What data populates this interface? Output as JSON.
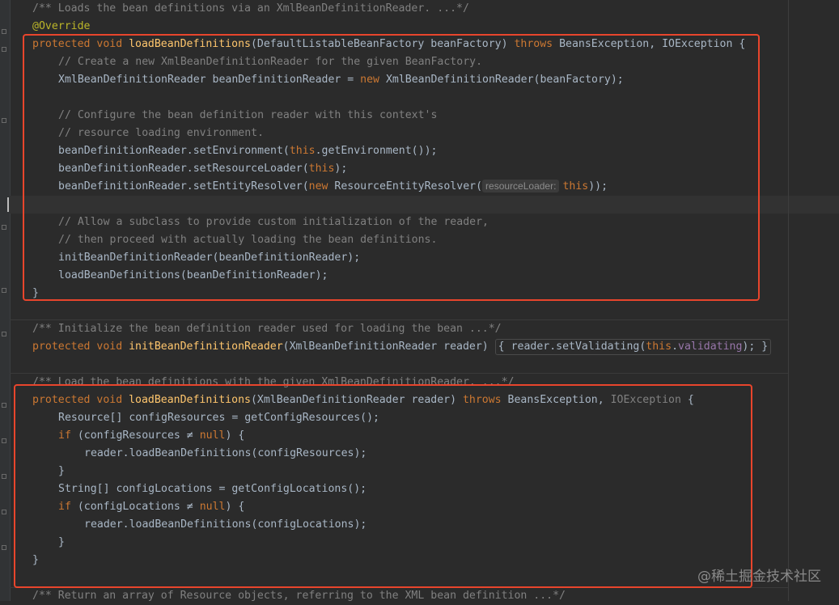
{
  "editor": {
    "block1": {
      "javadoc": "/** Loads the bean definitions via an XmlBeanDefinitionReader. ...*/",
      "annotation": "@Override",
      "sig_kw": "protected void ",
      "sig_fn": "loadBeanDefinitions",
      "sig_params": "(DefaultListableBeanFactory beanFactory) ",
      "sig_throws": "throws ",
      "sig_exc": "BeansException, IOException {",
      "c1": "// Create a new XmlBeanDefinitionReader for the given BeanFactory.",
      "l2_a": "XmlBeanDefinitionReader beanDefinitionReader = ",
      "l2_new": "new ",
      "l2_b": "XmlBeanDefinitionReader(beanFactory);",
      "c2": "// Configure the bean definition reader with this context's",
      "c3": "// resource loading environment.",
      "l3_a": "beanDefinitionReader.setEnvironment(",
      "l3_this": "this",
      "l3_b": ".getEnvironment());",
      "l4_a": "beanDefinitionReader.setResourceLoader(",
      "l4_this": "this",
      "l4_b": ");",
      "l5_a": "beanDefinitionReader.setEntityResolver(",
      "l5_new": "new ",
      "l5_b": "ResourceEntityResolver(",
      "l5_hint": "resourceLoader:",
      "l5_this": "this",
      "l5_c": "));",
      "c4": "// Allow a subclass to provide custom initialization of the reader,",
      "c5": "// then proceed with actually loading the bean definitions.",
      "l6": "initBeanDefinitionReader(beanDefinitionReader);",
      "l7": "loadBeanDefinitions(beanDefinitionReader);",
      "close": "}"
    },
    "block2": {
      "javadoc": "/** Initialize the bean definition reader used for loading the bean ...*/",
      "sig_kw": "protected void ",
      "sig_fn": "initBeanDefinitionReader",
      "sig_params": "(XmlBeanDefinitionReader reader) ",
      "fold_open": "{",
      "body_a": " reader.setValidating(",
      "body_this": "this",
      "body_dot": ".",
      "body_field": "validating",
      "body_b": "); ",
      "fold_close": "}"
    },
    "block3": {
      "javadoc": "/** Load the bean definitions with the given XmlBeanDefinitionReader. ...*/",
      "sig_kw": "protected void ",
      "sig_fn": "loadBeanDefinitions",
      "sig_params": "(XmlBeanDefinitionReader reader) ",
      "sig_throws": "throws ",
      "sig_exc1": "BeansException, ",
      "sig_exc2": "IOException",
      "sig_brace": " {",
      "l1": "Resource[] configResources = getConfigResources();",
      "if1_kw": "if ",
      "if1_a": "(configResources ≠ ",
      "if1_null": "null",
      "if1_b": ") {",
      "l2": "reader.loadBeanDefinitions(configResources);",
      "close_if1": "}",
      "l3": "String[] configLocations = getConfigLocations();",
      "if2_kw": "if ",
      "if2_a": "(configLocations ≠ ",
      "if2_null": "null",
      "if2_b": ") {",
      "l4": "reader.loadBeanDefinitions(configLocations);",
      "close_if2": "}",
      "close": "}"
    },
    "block4": {
      "javadoc": "/** Return an array of Resource objects, referring to the XML bean definition ...*/"
    }
  },
  "watermark": "@稀土掘金技术社区",
  "colors": {
    "background": "#2b2b2b",
    "keyword": "#cc7832",
    "method": "#ffc66d",
    "comment": "#808080",
    "annotation": "#bbb529",
    "field": "#9876aa",
    "highlight_box": "#e8452c"
  }
}
